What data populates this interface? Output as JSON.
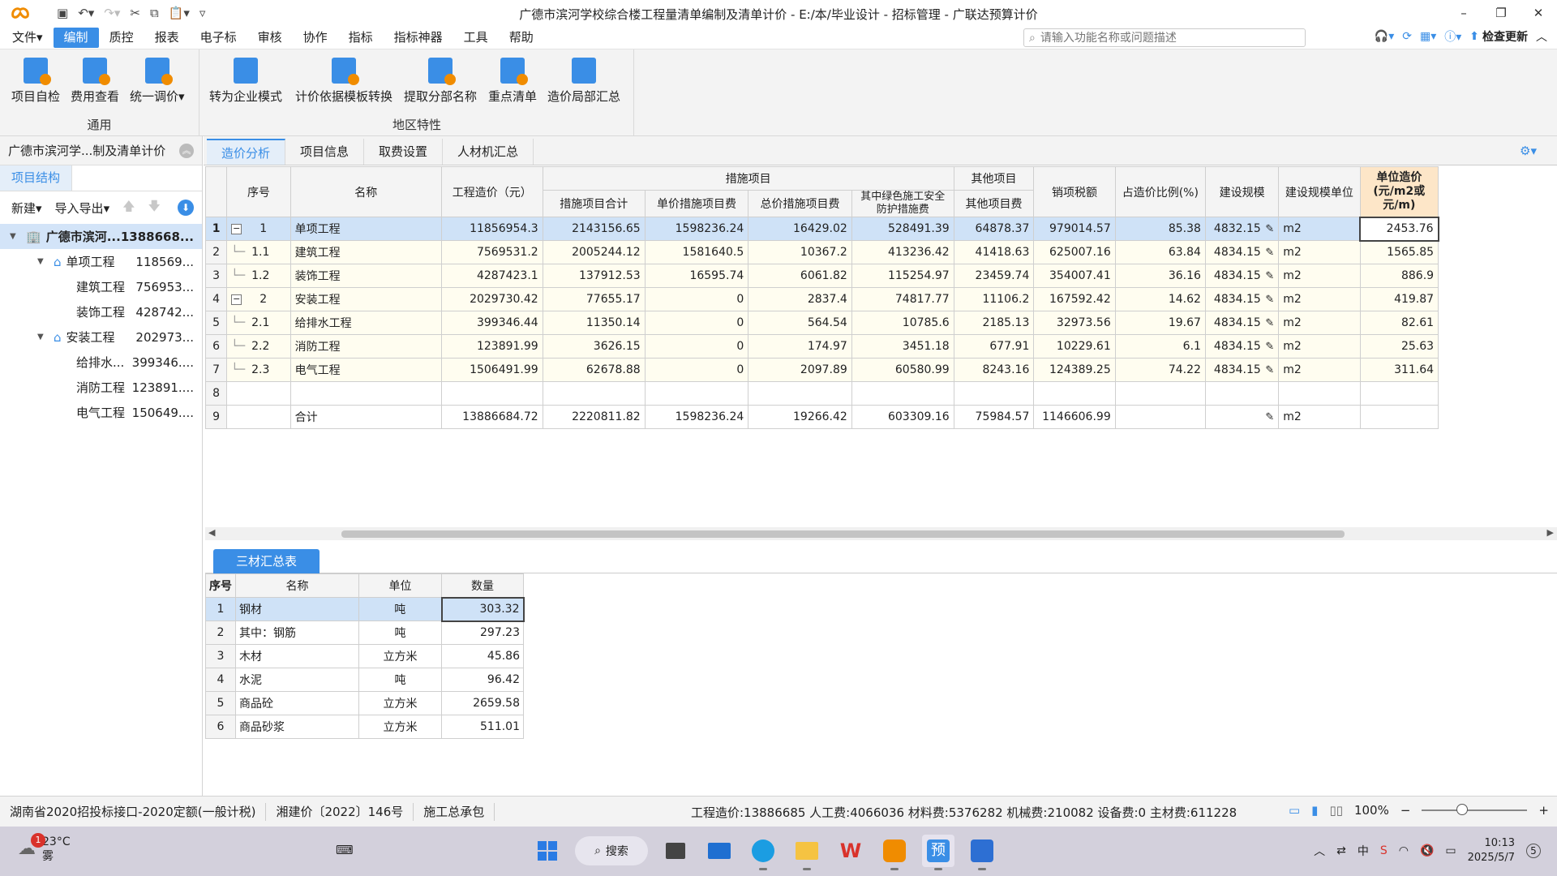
{
  "app": {
    "title": "广德市滨河学校综合楼工程量清单编制及清单计价 - E:/本/毕业设计 - 招标管理 - 广联达预算计价"
  },
  "menu": [
    "文件",
    "编制",
    "质控",
    "报表",
    "电子标",
    "审核",
    "协作",
    "指标",
    "指标神器",
    "工具",
    "帮助"
  ],
  "menu_active_index": 1,
  "search": {
    "placeholder": "请输入功能名称或问题描述"
  },
  "check_update": "检查更新",
  "ribbon": {
    "group1": {
      "label": "通用",
      "buttons": [
        "项目自检",
        "费用查看",
        "统一调价"
      ]
    },
    "group2": {
      "label": "地区特性",
      "buttons": [
        "转为企业模式",
        "计价依据模板转换",
        "提取分部名称",
        "重点清单",
        "造价局部汇总"
      ]
    }
  },
  "left": {
    "title": "广德市滨河学...制及清单计价",
    "tab": "项目结构",
    "toolbar": {
      "new": "新建",
      "import_export": "导入导出"
    },
    "tree": [
      {
        "label": "广德市滨河...",
        "value": "1388668...",
        "level": 0
      },
      {
        "label": "单项工程",
        "value": "118569...",
        "level": 1
      },
      {
        "label": "建筑工程",
        "value": "756953...",
        "level": 2
      },
      {
        "label": "装饰工程",
        "value": "428742...",
        "level": 2
      },
      {
        "label": "安装工程",
        "value": "202973...",
        "level": 1
      },
      {
        "label": "给排水...",
        "value": "399346....",
        "level": 2
      },
      {
        "label": "消防工程",
        "value": "123891....",
        "level": 2
      },
      {
        "label": "电气工程",
        "value": "150649....",
        "level": 2
      }
    ]
  },
  "tabs": [
    "造价分析",
    "项目信息",
    "取费设置",
    "人材机汇总"
  ],
  "grid": {
    "headers": {
      "seq": "序号",
      "name": "名称",
      "cost": "工程造价（元）",
      "measures": "措施项目",
      "measures_total": "措施项目合计",
      "unit_measures": "单价措施项目费",
      "total_measures": "总价措施项目费",
      "green_safety": "其中绿色施工安全防护措施费",
      "other": "其他项目",
      "other_fee": "其他项目费",
      "tax": "销项税额",
      "ratio": "占造价比例(%)",
      "scale": "建设规模",
      "scale_unit": "建设规模单位",
      "unit_cost": "单位造价(元/m2或元/m)"
    },
    "rows": [
      {
        "rn": "1",
        "seq": "1",
        "name": "单项工程",
        "cost": "11856954.3",
        "mt": "2143156.65",
        "um": "1598236.24",
        "tm": "16429.02",
        "gs": "528491.39",
        "of": "64878.37",
        "tax": "979014.57",
        "ratio": "85.38",
        "scale": "4832.15",
        "unit": "m2",
        "uc": "2453.76"
      },
      {
        "rn": "2",
        "seq": "1.1",
        "name": "建筑工程",
        "cost": "7569531.2",
        "mt": "2005244.12",
        "um": "1581640.5",
        "tm": "10367.2",
        "gs": "413236.42",
        "of": "41418.63",
        "tax": "625007.16",
        "ratio": "63.84",
        "scale": "4834.15",
        "unit": "m2",
        "uc": "1565.85"
      },
      {
        "rn": "3",
        "seq": "1.2",
        "name": "装饰工程",
        "cost": "4287423.1",
        "mt": "137912.53",
        "um": "16595.74",
        "tm": "6061.82",
        "gs": "115254.97",
        "of": "23459.74",
        "tax": "354007.41",
        "ratio": "36.16",
        "scale": "4834.15",
        "unit": "m2",
        "uc": "886.9"
      },
      {
        "rn": "4",
        "seq": "2",
        "name": "安装工程",
        "cost": "2029730.42",
        "mt": "77655.17",
        "um": "0",
        "tm": "2837.4",
        "gs": "74817.77",
        "of": "11106.2",
        "tax": "167592.42",
        "ratio": "14.62",
        "scale": "4834.15",
        "unit": "m2",
        "uc": "419.87"
      },
      {
        "rn": "5",
        "seq": "2.1",
        "name": "给排水工程",
        "cost": "399346.44",
        "mt": "11350.14",
        "um": "0",
        "tm": "564.54",
        "gs": "10785.6",
        "of": "2185.13",
        "tax": "32973.56",
        "ratio": "19.67",
        "scale": "4834.15",
        "unit": "m2",
        "uc": "82.61"
      },
      {
        "rn": "6",
        "seq": "2.2",
        "name": "消防工程",
        "cost": "123891.99",
        "mt": "3626.15",
        "um": "0",
        "tm": "174.97",
        "gs": "3451.18",
        "of": "677.91",
        "tax": "10229.61",
        "ratio": "6.1",
        "scale": "4834.15",
        "unit": "m2",
        "uc": "25.63"
      },
      {
        "rn": "7",
        "seq": "2.3",
        "name": "电气工程",
        "cost": "1506491.99",
        "mt": "62678.88",
        "um": "0",
        "tm": "2097.89",
        "gs": "60580.99",
        "of": "8243.16",
        "tax": "124389.25",
        "ratio": "74.22",
        "scale": "4834.15",
        "unit": "m2",
        "uc": "311.64"
      },
      {
        "rn": "8",
        "seq": "",
        "name": "",
        "cost": "",
        "mt": "",
        "um": "",
        "tm": "",
        "gs": "",
        "of": "",
        "tax": "",
        "ratio": "",
        "scale": "",
        "unit": "",
        "uc": ""
      },
      {
        "rn": "9",
        "seq": "",
        "name": "合计",
        "cost": "13886684.72",
        "mt": "2220811.82",
        "um": "1598236.24",
        "tm": "19266.42",
        "gs": "603309.16",
        "of": "75984.57",
        "tax": "1146606.99",
        "ratio": "",
        "scale": "",
        "unit": "m2",
        "uc": ""
      }
    ]
  },
  "materials": {
    "tab": "三材汇总表",
    "headers": {
      "seq": "序号",
      "name": "名称",
      "unit": "单位",
      "qty": "数量"
    },
    "rows": [
      {
        "rn": "1",
        "name": "钢材",
        "unit": "吨",
        "qty": "303.32"
      },
      {
        "rn": "2",
        "name": "其中：钢筋",
        "unit": "吨",
        "qty": "297.23"
      },
      {
        "rn": "3",
        "name": "木材",
        "unit": "立方米",
        "qty": "45.86"
      },
      {
        "rn": "4",
        "name": "水泥",
        "unit": "吨",
        "qty": "96.42"
      },
      {
        "rn": "5",
        "name": "商品砼",
        "unit": "立方米",
        "qty": "2659.58"
      },
      {
        "rn": "6",
        "name": "商品砂浆",
        "unit": "立方米",
        "qty": "511.01"
      }
    ]
  },
  "status": {
    "seg1": "湖南省2020招投标接口-2020定额(一般计税)",
    "seg2": "湘建价〔2022〕146号",
    "seg3": "施工总承包",
    "stats": "工程造价:13886685  人工费:4066036  材料费:5376282  机械费:210082  设备费:0  主材费:611228",
    "zoom": "100%"
  },
  "taskbar": {
    "temp": "23°C",
    "weather": "雾",
    "badge": "1",
    "search": "搜索",
    "ime": "中",
    "time": "10:13",
    "date": "2025/5/7",
    "notif": "5"
  },
  "colors": {
    "accent": "#3a8ee6",
    "selected_row": "#cfe2f7",
    "highlight_header": "#fde6c8"
  }
}
